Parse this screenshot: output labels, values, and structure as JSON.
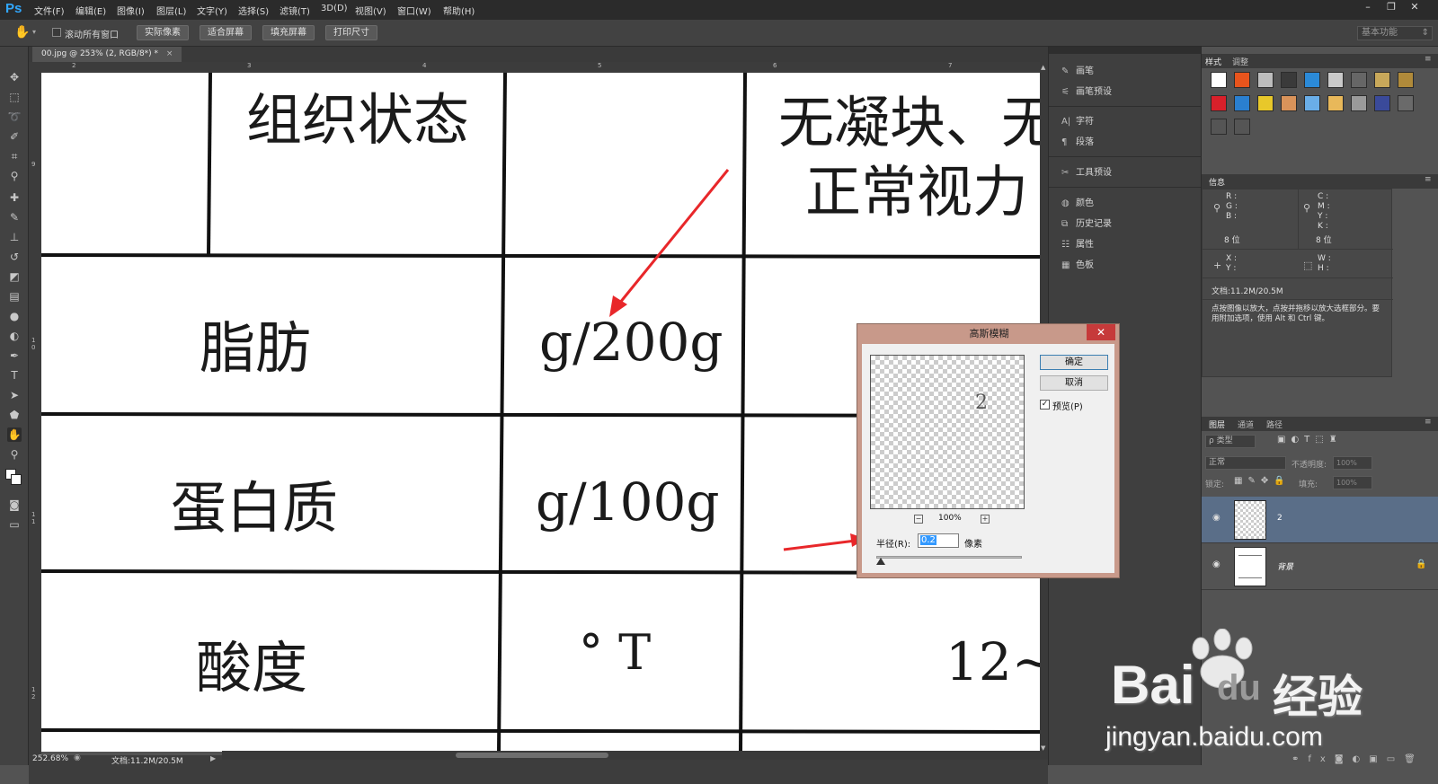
{
  "app": {
    "logo": "Ps",
    "menus": [
      "文件(F)",
      "编辑(E)",
      "图像(I)",
      "图层(L)",
      "文字(Y)",
      "选择(S)",
      "滤镜(T)",
      "3D(D)",
      "视图(V)",
      "窗口(W)",
      "帮助(H)"
    ],
    "window_buttons": [
      "–",
      "❐",
      "✕"
    ]
  },
  "options": {
    "scroll_all_label": "滚动所有窗口",
    "buttons": [
      "实际像素",
      "适合屏幕",
      "填充屏幕",
      "打印尺寸"
    ],
    "workspace": "基本功能"
  },
  "document": {
    "tab_title": "00.jpg @ 253% (2, RGB/8*) *",
    "ruler_top": [
      "2",
      "3",
      "4",
      "5",
      "6",
      "7"
    ],
    "ruler_left": [
      "9",
      "1 0",
      "1 1",
      "1 2"
    ],
    "rows": [
      {
        "label": "组织状态",
        "unit": "",
        "value": "无凝块、无",
        "value2": "正常视力"
      },
      {
        "label": "脂肪",
        "unit": "g/200g",
        "value": "",
        "value2": ""
      },
      {
        "label": "蛋白质",
        "unit": "g/100g",
        "value": "",
        "value2": ""
      },
      {
        "label": "酸度",
        "unit": "° T",
        "value": "12~",
        "value2": ""
      }
    ]
  },
  "status": {
    "zoom": "252.68%",
    "doc_info": "文档:11.2M/20.5M"
  },
  "mid_panel": {
    "items": [
      {
        "icon": "brush-icon",
        "glyph": "✎",
        "label": "画笔"
      },
      {
        "icon": "brush-preset-icon",
        "glyph": "⚟",
        "label": "画笔预设"
      },
      {
        "icon": "character-icon",
        "glyph": "A|",
        "label": "字符"
      },
      {
        "icon": "paragraph-icon",
        "glyph": "¶",
        "label": "段落"
      },
      {
        "icon": "tool-preset-icon",
        "glyph": "✂",
        "label": "工具预设"
      },
      {
        "icon": "color-icon",
        "glyph": "◍",
        "label": "颜色"
      },
      {
        "icon": "history-icon",
        "glyph": "⧉",
        "label": "历史记录"
      },
      {
        "icon": "properties-icon",
        "glyph": "☷",
        "label": "属性"
      },
      {
        "icon": "swatches-icon",
        "glyph": "▦",
        "label": "色板"
      }
    ]
  },
  "styles_panel": {
    "tabs": [
      "样式",
      "调整"
    ],
    "swatch_colors": [
      "#ffffff",
      "#e8541c",
      "#bdbdbd",
      "#3a3a3a",
      "#2b8ad8",
      "#c9c9c9",
      "#666666",
      "#c8a85a",
      "#b08a3a",
      "#d8202a",
      "#2a7fd0",
      "#e8c82a",
      "#d9935a",
      "#6aaee8",
      "#e8b85a",
      "#9a9a9a",
      "#3a4a9a",
      "#6a6a6a",
      "#555555",
      "#555555"
    ]
  },
  "info_panel": {
    "title": "信息",
    "rgb": [
      "R :",
      "G :",
      "B :"
    ],
    "cmyk": [
      "C :",
      "M :",
      "Y :",
      "K :"
    ],
    "bits_left": "8 位",
    "bits_right": "8 位",
    "xy": [
      "X :",
      "Y :"
    ],
    "wh": [
      "W :",
      "H :"
    ],
    "doc": "文档:11.2M/20.5M",
    "hint": "点按图像以放大，点按并拖移以放大选框部分。要用附加选项，使用 Alt 和 Ctrl 键。"
  },
  "layers_panel": {
    "tabs": [
      "图层",
      "通道",
      "路径"
    ],
    "filter_kind": "ρ 类型",
    "blend_mode": "正常",
    "opacity_label": "不透明度:",
    "opacity_value": "100%",
    "lock_label": "锁定:",
    "fill_label": "填充:",
    "fill_value": "100%",
    "layers": [
      {
        "name": "2",
        "selected": true
      },
      {
        "name": "背景",
        "selected": false
      }
    ]
  },
  "dialog": {
    "title": "高斯模糊",
    "ok": "确定",
    "cancel": "取消",
    "preview_label": "预览(P)",
    "preview_checked": true,
    "preview_text": "2",
    "zoom": "100%",
    "radius_label": "半径(R):",
    "radius_value": "0.2",
    "radius_unit": "像素"
  },
  "watermark": {
    "brand": "Bai",
    "brand2": "du",
    "suffix": "经验",
    "url": "jingyan.baidu.com"
  }
}
